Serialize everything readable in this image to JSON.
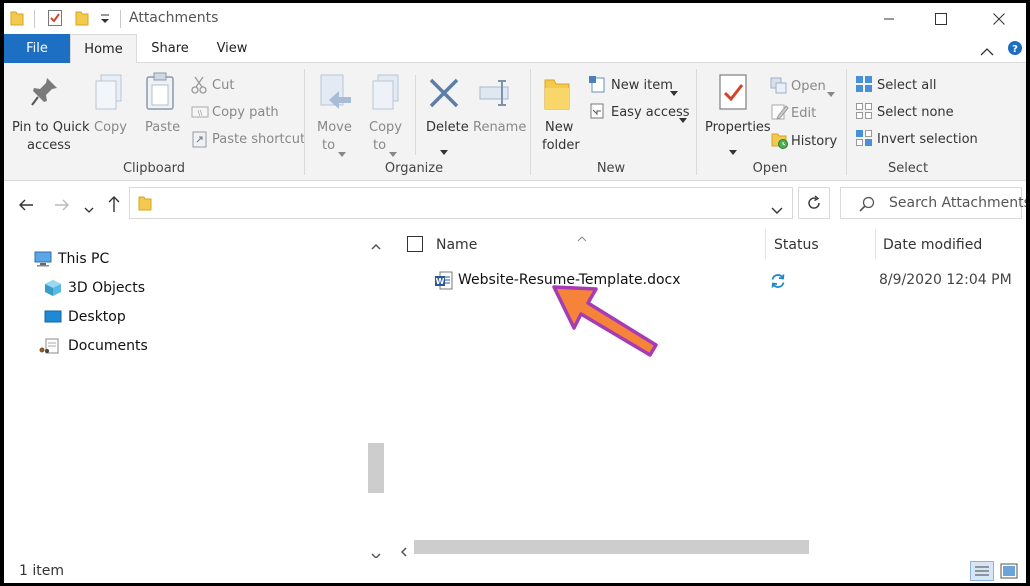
{
  "window": {
    "title": "Attachments"
  },
  "tabs": [
    {
      "label": "File"
    },
    {
      "label": "Home"
    },
    {
      "label": "Share"
    },
    {
      "label": "View"
    }
  ],
  "ribbon": {
    "clipboard": {
      "pin_line1": "Pin to Quick",
      "pin_line2": "access",
      "copy": "Copy",
      "paste": "Paste",
      "cut": "Cut",
      "copy_path": "Copy path",
      "paste_shortcut": "Paste shortcut",
      "group": "Clipboard"
    },
    "organize": {
      "move_line1": "Move",
      "move_line2": "to",
      "copy_line1": "Copy",
      "copy_line2": "to",
      "delete": "Delete",
      "rename": "Rename",
      "group": "Organize"
    },
    "new": {
      "folder_line1": "New",
      "folder_line2": "folder",
      "new_item": "New item",
      "easy_access": "Easy access",
      "group": "New"
    },
    "open": {
      "properties": "Properties",
      "open": "Open",
      "edit": "Edit",
      "history": "History",
      "group": "Open"
    },
    "select": {
      "select_all": "Select all",
      "select_none": "Select none",
      "invert": "Invert selection",
      "group": "Select"
    }
  },
  "search": {
    "placeholder": "Search Attachments"
  },
  "nav": {
    "items": [
      {
        "label": "This PC",
        "icon": "computer-icon"
      },
      {
        "label": "3D Objects",
        "icon": "cube-icon"
      },
      {
        "label": "Desktop",
        "icon": "desktop-icon"
      },
      {
        "label": "Documents",
        "icon": "documents-icon"
      }
    ]
  },
  "list": {
    "columns": [
      {
        "label": "Name"
      },
      {
        "label": "Status"
      },
      {
        "label": "Date modified"
      }
    ],
    "files": [
      {
        "name": "Website-Resume-Template.docx",
        "date": "8/9/2020 12:04 PM",
        "icon": "word-doc-icon",
        "status_icon": "sync-icon"
      }
    ]
  },
  "status": {
    "count": "1 item"
  },
  "colors": {
    "accent": "#1d6fc4",
    "folder": "#f3c94e",
    "annotation_arrow": "#f5843a",
    "annotation_outline": "#a63bb5"
  }
}
